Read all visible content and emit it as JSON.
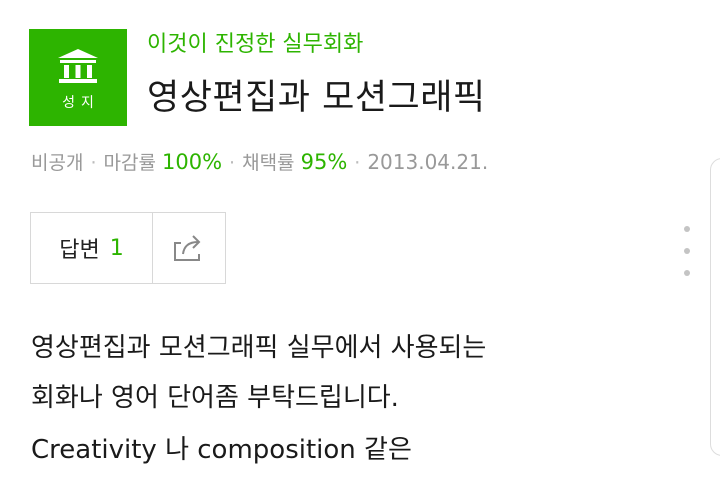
{
  "badge": {
    "label": "성지",
    "icon": "shrine-pillars-icon",
    "color": "#2db400"
  },
  "category": "이것이 진정한 실무회화",
  "title": "영상편집과 모션그래픽",
  "meta": {
    "visibility": "비공개",
    "deadline_label": "마감률",
    "deadline_value": "100%",
    "adopt_label": "채택률",
    "adopt_value": "95%",
    "date": "2013.04.21."
  },
  "actions": {
    "answer_label": "답변",
    "answer_count": "1",
    "share_icon": "share-icon",
    "more_icon": "more-vertical-icon"
  },
  "body": {
    "line1": "영상편집과 모션그래픽 실무에서 사용되는",
    "line2": "회화나 영어 단어좀 부탁드립니다.",
    "line3": "Creativity 나 composition 같은"
  },
  "colors": {
    "accent": "#2db400",
    "text": "#1a1a1a",
    "muted": "#999999"
  }
}
